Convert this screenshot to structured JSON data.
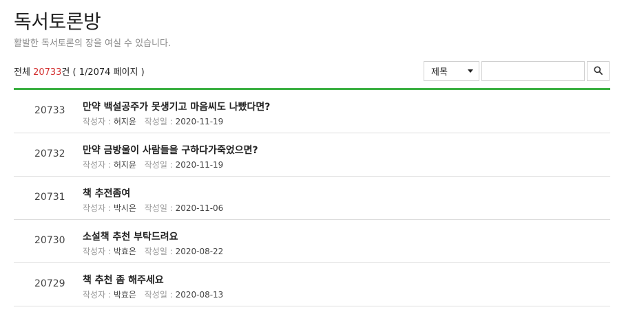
{
  "header": {
    "title": "독서토론방",
    "subtitle": "활발한 독서토론의 장을 여실 수 있습니다."
  },
  "summary": {
    "prefix": "전체 ",
    "count": "20733",
    "suffix": "건 ( 1/2074 페이지 )"
  },
  "search": {
    "field_selected": "제목",
    "query_value": "",
    "query_placeholder": "",
    "icon": "search-icon"
  },
  "accent_color": "#3cb043",
  "count_color": "#d32f2f",
  "meta_labels": {
    "author": "작성자 :",
    "date": "작성일 :"
  },
  "posts": [
    {
      "number": "20733",
      "title": "만약 백설공주가 못생기고 마음씨도 나빴다면?",
      "author": "허지윤",
      "date": "2020-11-19"
    },
    {
      "number": "20732",
      "title": "만약 금방울이 사람들을 구하다가죽었으면?",
      "author": "허지윤",
      "date": "2020-11-19"
    },
    {
      "number": "20731",
      "title": "책 추전좀여",
      "author": "박시은",
      "date": "2020-11-06"
    },
    {
      "number": "20730",
      "title": "소설책 추천 부탁드려요",
      "author": "박효은",
      "date": "2020-08-22"
    },
    {
      "number": "20729",
      "title": "책 추천 좀 해주세요",
      "author": "박효은",
      "date": "2020-08-13"
    }
  ]
}
